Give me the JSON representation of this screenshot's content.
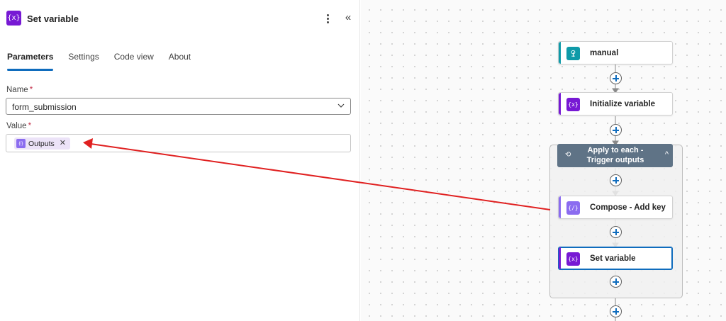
{
  "panel": {
    "title": "Set variable",
    "icon": "{x}",
    "more_label": "⋮",
    "collapse_label": "«",
    "tabs": [
      {
        "label": "Parameters",
        "active": true
      },
      {
        "label": "Settings",
        "active": false
      },
      {
        "label": "Code view",
        "active": false
      },
      {
        "label": "About",
        "active": false
      }
    ],
    "name_field": {
      "label": "Name",
      "required_mark": "*",
      "value": "form_submission"
    },
    "value_field": {
      "label": "Value",
      "required_mark": "*",
      "token_label": "Outputs",
      "token_icon": "{/}",
      "token_close": "✕"
    }
  },
  "flow": {
    "nodes": [
      {
        "label": "manual",
        "icon": "trigger-icon",
        "color": "#0f9aa8"
      },
      {
        "label": "Initialize variable",
        "icon": "{x}",
        "color": "#7719d4"
      },
      {
        "label": "Compose - Add key",
        "icon": "{/}",
        "color": "#8b6cf0"
      },
      {
        "label": "Set variable",
        "icon": "{x}",
        "color": "#7719d4"
      }
    ],
    "scope": {
      "title_line1": "Apply to each -",
      "title_line2": "Trigger outputs",
      "icon": "⟲",
      "chevron": "^",
      "color": "#5f7386"
    }
  },
  "colors": {
    "accent": "#0f6cbd",
    "variable": "#7719d4",
    "compose": "#8b6cf0",
    "annotation": "#e02020"
  }
}
